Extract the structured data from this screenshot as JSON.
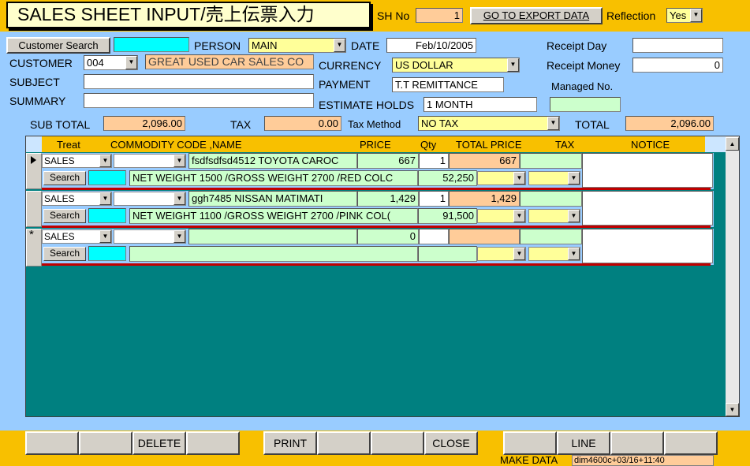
{
  "title": "SALES SHEET INPUT/売上伝票入力",
  "sh_no_label": "SH No",
  "sh_no": "1",
  "go_export": "GO TO EXPORT DATA",
  "reflection_label": "Reflection",
  "reflection": "Yes",
  "customer_search": "Customer Search",
  "person_label": "PERSON",
  "person": "MAIN",
  "date_label": "DATE",
  "date": "Feb/10/2005",
  "receipt_day_label": "Receipt Day",
  "customer_label": "CUSTOMER",
  "customer_code": "004",
  "customer_name": "GREAT USED CAR SALES CO",
  "currency_label": "CURRENCY",
  "currency": "US DOLLAR",
  "receipt_money_label": "Receipt Money",
  "receipt_money": "0",
  "subject_label": "SUBJECT",
  "payment_label": "PAYMENT",
  "payment": "T.T REMITTANCE",
  "managed_label": "Managed No.",
  "summary_label": "SUMMARY",
  "estimate_label": "ESTIMATE HOLDS",
  "estimate": "1 MONTH",
  "subtotal_label": "SUB TOTAL",
  "subtotal": "2,096.00",
  "tax_label": "TAX",
  "tax": "0.00",
  "tax_method_label": "Tax Method",
  "tax_method": "NO TAX",
  "total_label": "TOTAL",
  "total": "2,096.00",
  "grid_headers": {
    "treat": "Treat",
    "commodity": "COMMODITY CODE ,NAME",
    "price": "PRICE",
    "qty": "Qty",
    "total_price": "TOTAL PRICE",
    "tax": "TAX",
    "notice": "NOTICE"
  },
  "rows": [
    {
      "treat": "SALES",
      "name": "fsdfsdfsd4512 TOYOTA CAROC",
      "price": "667",
      "qty": "1",
      "total": "667",
      "search": "Search",
      "desc": "NET WEIGHT 1500 /GROSS WEIGHT 2700 /RED COLC",
      "amount": "52,250"
    },
    {
      "treat": "SALES",
      "name": "ggh7485 NISSAN MATIMATI",
      "price": "1,429",
      "qty": "1",
      "total": "1,429",
      "search": "Search",
      "desc": "NET WEIGHT 1100 /GROSS WEIGHT 2700 /PINK COL(",
      "amount": "91,500"
    },
    {
      "treat": "SALES",
      "name": "",
      "price": "0",
      "qty": "",
      "total": "",
      "search": "Search",
      "desc": "",
      "amount": ""
    }
  ],
  "new_row_marker": "*",
  "footer": {
    "b1": "",
    "b2": "",
    "delete": "DELETE",
    "b4": "",
    "print": "PRINT",
    "b6": "",
    "b7": "",
    "close": "CLOSE",
    "b9": "",
    "line": "LINE",
    "b11": "",
    "b12": ""
  },
  "make_data_label": "MAKE DATA",
  "make_data": "dim4600c+03/16+11:40"
}
